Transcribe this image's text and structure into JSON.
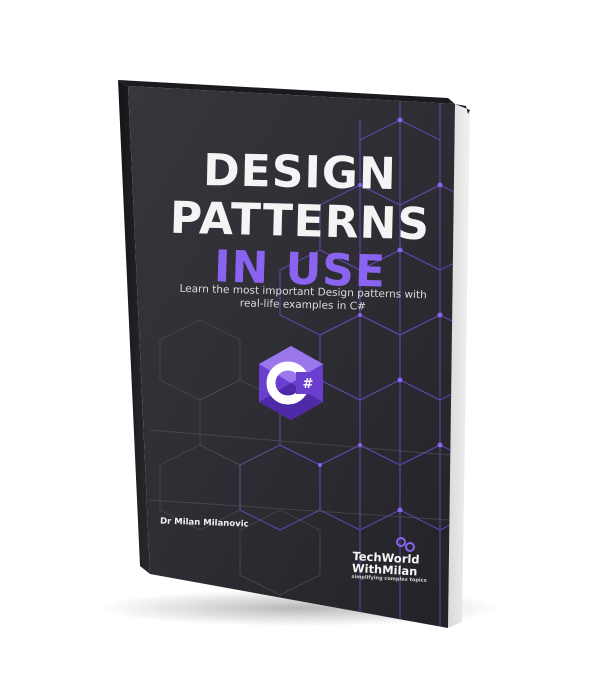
{
  "book": {
    "title_line1": "DESIGN",
    "title_line2": "PATTERNS",
    "title_line3": "IN USE",
    "subtitle": "Learn the most important Design patterns with real-life examples in C#",
    "logo_text": "C#",
    "author": "Dr Milan Milanovic",
    "brand_line1": "TechWorld",
    "brand_line2": "WithMilan",
    "brand_tagline": "simplifying complex topics"
  },
  "colors": {
    "cover": "#2e2d33",
    "accent_purple": "#8a64f0",
    "title_white": "#f4f4f4"
  }
}
